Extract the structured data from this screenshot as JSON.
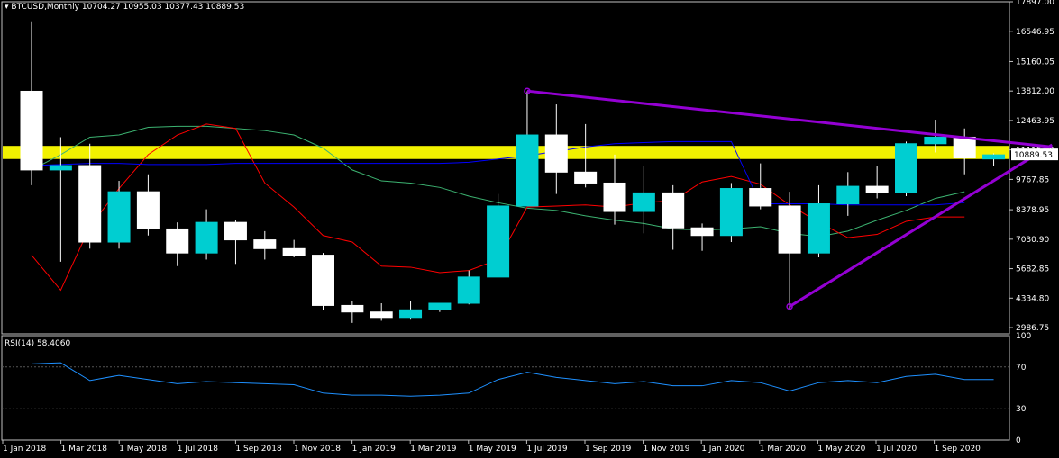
{
  "header": {
    "symbol_label": "BTCUSD,Monthly",
    "ohlc_label": "10704.27 10955.03 10377.43 10889.53",
    "indicator_label": "RSI(14) 58.4060"
  },
  "colors": {
    "background": "#000000",
    "bull_candle": "#00CED1",
    "bear_candle": "#FFFFFF",
    "trendline": "#9400D3",
    "bb_band": "#3CB371",
    "ma_fast": "#00FF00",
    "ma_red": "#FF0000",
    "ma_blue": "#0000FF",
    "zone": "#FFFF00",
    "rsi": "#1E90FF",
    "price_box": "#FFFFFF"
  },
  "chart_data": [
    {
      "type": "candlestick",
      "title": "BTCUSD,Monthly",
      "x": [
        "2018-01",
        "2018-02",
        "2018-03",
        "2018-04",
        "2018-05",
        "2018-06",
        "2018-07",
        "2018-08",
        "2018-09",
        "2018-10",
        "2018-11",
        "2018-12",
        "2019-01",
        "2019-02",
        "2019-03",
        "2019-04",
        "2019-05",
        "2019-06",
        "2019-07",
        "2019-08",
        "2019-09",
        "2019-10",
        "2019-11",
        "2019-12",
        "2020-01",
        "2020-02",
        "2020-03",
        "2020-04",
        "2020-05",
        "2020-06",
        "2020-07",
        "2020-08",
        "2020-09",
        "2020-10"
      ],
      "x_tick_labels": [
        "1 Jan 2018",
        "1 Mar 2018",
        "1 May 2018",
        "1 Jul 2018",
        "1 Sep 2018",
        "1 Nov 2018",
        "1 Jan 2019",
        "1 Mar 2019",
        "1 May 2019",
        "1 Jul 2019",
        "1 Sep 2019",
        "1 Nov 2019",
        "1 Jan 2020",
        "1 Mar 2020",
        "1 May 2020",
        "1 Jul 2020",
        "1 Sep 2020"
      ],
      "y_tick_labels": [
        "17897.00",
        "16546.95",
        "15160.05",
        "13812.00",
        "12463.95",
        "11115.90",
        "9767.85",
        "8378.95",
        "7030.90",
        "5682.85",
        "4334.80",
        "2986.75"
      ],
      "ylim": [
        2700,
        17897
      ],
      "ohlc": [
        [
          13800,
          17000,
          9500,
          10200
        ],
        [
          10200,
          11700,
          6000,
          10400
        ],
        [
          10400,
          11400,
          6600,
          6900
        ],
        [
          6900,
          9700,
          6600,
          9200
        ],
        [
          9200,
          10000,
          7200,
          7500
        ],
        [
          7500,
          7800,
          5800,
          6400
        ],
        [
          6400,
          8400,
          6100,
          7800
        ],
        [
          7800,
          7900,
          5900,
          7000
        ],
        [
          7000,
          7400,
          6100,
          6600
        ],
        [
          6600,
          7000,
          6200,
          6300
        ],
        [
          6300,
          6400,
          3800,
          4000
        ],
        [
          4000,
          4200,
          3200,
          3700
        ],
        [
          3700,
          4100,
          3300,
          3450
        ],
        [
          3450,
          4200,
          3350,
          3800
        ],
        [
          3800,
          4100,
          3700,
          4100
        ],
        [
          4100,
          5600,
          4050,
          5300
        ],
        [
          5300,
          9100,
          5300,
          8550
        ],
        [
          8550,
          13800,
          8550,
          11800
        ],
        [
          11800,
          13200,
          9100,
          10100
        ],
        [
          10100,
          12300,
          9400,
          9600
        ],
        [
          9600,
          10900,
          7700,
          8300
        ],
        [
          8300,
          10400,
          7300,
          9150
        ],
        [
          9150,
          9500,
          6550,
          7550
        ],
        [
          7550,
          7750,
          6500,
          7200
        ],
        [
          7200,
          9600,
          6900,
          9350
        ],
        [
          9350,
          10500,
          8400,
          8550
        ],
        [
          8550,
          9200,
          3850,
          6400
        ],
        [
          6400,
          9500,
          6200,
          8650
        ],
        [
          8650,
          10100,
          8100,
          9450
        ],
        [
          9450,
          10400,
          8900,
          9150
        ],
        [
          9150,
          11500,
          9000,
          11400
        ],
        [
          11400,
          12500,
          11000,
          11700
        ],
        [
          11700,
          12100,
          10000,
          10750
        ],
        [
          10704.27,
          10955.03,
          10377.43,
          10889.53
        ]
      ],
      "current_price": "10889.53",
      "series": [
        {
          "values": [
            10200,
            10900,
            11700,
            11800,
            12150,
            12200,
            12200,
            12100,
            12000,
            11800,
            11200,
            10200,
            9700,
            9600,
            9400,
            9000,
            8700,
            8450,
            8350,
            8100,
            7900,
            7750,
            7500,
            7450,
            7500,
            7600,
            7300,
            7150,
            7400,
            7900,
            8350,
            8900,
            9200
          ]
        },
        {
          "values": [
            6300,
            4700,
            7600,
            9350,
            10900,
            11800,
            12300,
            12100,
            9600,
            8500,
            7200,
            6900,
            5800,
            5750,
            5500,
            5600,
            6100,
            8500,
            8550,
            8600,
            8500,
            8700,
            8800,
            9650,
            9900,
            9550,
            8600,
            7800,
            7100,
            7250,
            7850,
            8050,
            8050
          ]
        },
        {
          "values": [
            10400,
            10450,
            10500,
            10500,
            10450,
            10450,
            10450,
            10500,
            10500,
            10500,
            10500,
            10500,
            10500,
            10500,
            10500,
            10550,
            10700,
            10850,
            11050,
            11250,
            11400,
            11450,
            11500,
            11500,
            11500,
            8650,
            8650,
            8650,
            8600,
            8600,
            8600,
            8600,
            8700
          ]
        }
      ],
      "trendlines": [
        {
          "x1": "2019-06",
          "y1": 13812,
          "x2": "2020-12",
          "y2": 11250
        },
        {
          "x1": "2020-03",
          "y1": 3950,
          "x2": "2020-12",
          "y2": 11350
        }
      ],
      "zone": {
        "low": 10700,
        "high": 11300
      }
    },
    {
      "type": "line",
      "title": "RSI(14) 58.4060",
      "x_tick_labels": [],
      "y_tick_labels": [
        "100",
        "70",
        "30",
        "0"
      ],
      "ylim": [
        0,
        100
      ],
      "series": [
        {
          "name": "RSI(14)",
          "values": [
            73,
            74,
            57,
            62,
            58,
            54,
            56,
            55,
            54,
            53,
            45,
            43,
            43,
            42,
            43,
            45,
            58,
            65,
            60,
            57,
            54,
            56,
            52,
            52,
            57,
            55,
            47,
            55,
            57,
            55,
            61,
            63,
            58,
            58
          ]
        }
      ]
    }
  ]
}
